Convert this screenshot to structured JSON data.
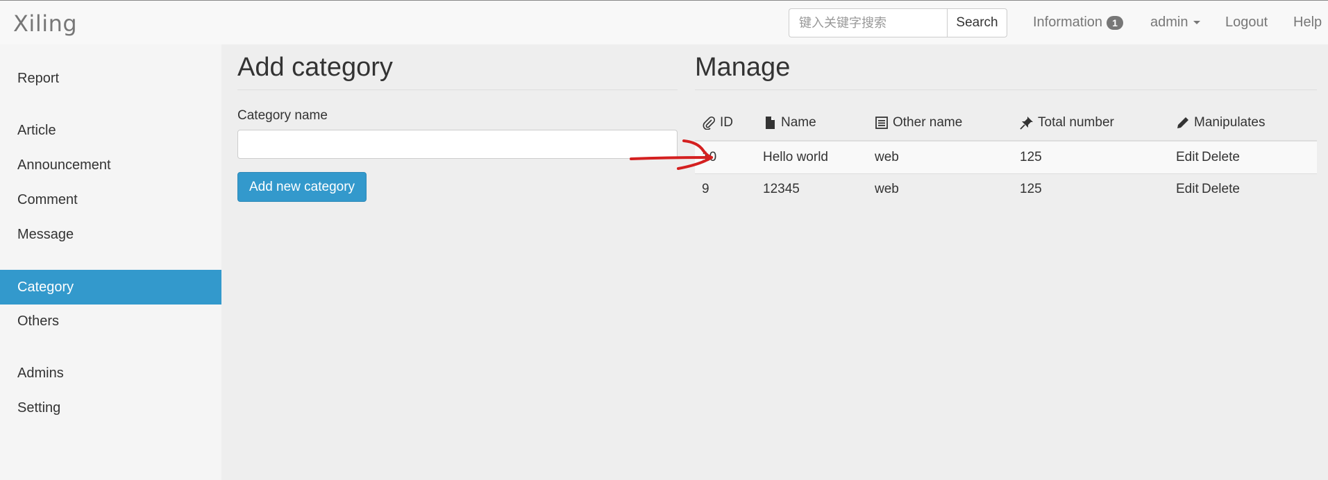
{
  "brand": "Xiling",
  "search": {
    "placeholder": "键入关键字搜索",
    "value": "",
    "button_label": "Search"
  },
  "nav": {
    "information_label": "Information",
    "information_count": "1",
    "user_label": "admin",
    "logout_label": "Logout",
    "help_label": "Help"
  },
  "sidebar": {
    "items": [
      {
        "label": "Report",
        "active": false
      },
      {
        "label": "Article",
        "active": false
      },
      {
        "label": "Announcement",
        "active": false
      },
      {
        "label": "Comment",
        "active": false
      },
      {
        "label": "Message",
        "active": false
      },
      {
        "label": "Category",
        "active": true
      },
      {
        "label": "Others",
        "active": false
      },
      {
        "label": "Admins",
        "active": false
      },
      {
        "label": "Setting",
        "active": false
      }
    ]
  },
  "add_panel": {
    "title": "Add category",
    "field_label": "Category name",
    "field_value": "",
    "submit_label": "Add new category"
  },
  "manage_panel": {
    "title": "Manage",
    "columns": [
      {
        "label": "ID",
        "icon": "paperclip-icon"
      },
      {
        "label": "Name",
        "icon": "file-icon"
      },
      {
        "label": "Other name",
        "icon": "list-icon"
      },
      {
        "label": "Total number",
        "icon": "pushpin-icon"
      },
      {
        "label": "Manipulates",
        "icon": "pencil-icon"
      }
    ],
    "rows": [
      {
        "id": "10",
        "name": "Hello world",
        "other_name": "web",
        "total": "125",
        "edit": "Edit",
        "delete": "Delete"
      },
      {
        "id": "9",
        "name": "12345",
        "other_name": "web",
        "total": "125",
        "edit": "Edit",
        "delete": "Delete"
      }
    ]
  },
  "colors": {
    "accent": "#3399cc",
    "annotation": "#d42020",
    "row_stripe": "#f9f9f9"
  }
}
